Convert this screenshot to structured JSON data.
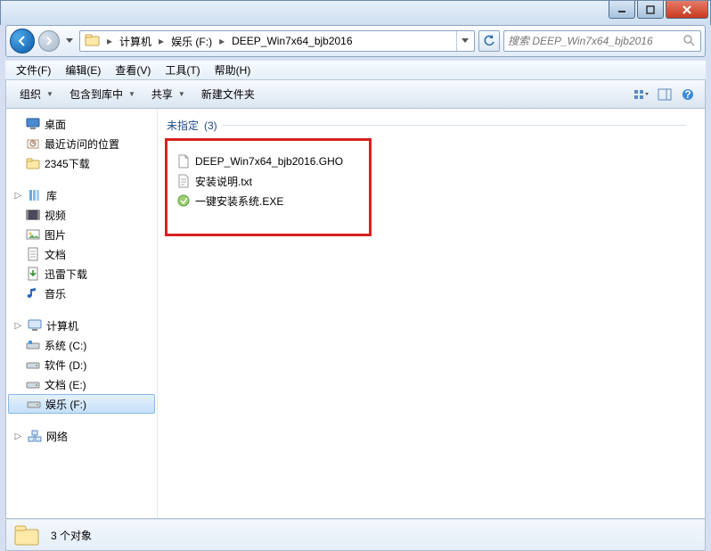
{
  "titlebar": {},
  "nav": {
    "breadcrumb": [
      "计算机",
      "娱乐 (F:)",
      "DEEP_Win7x64_bjb2016"
    ]
  },
  "search": {
    "placeholder": "搜索 DEEP_Win7x64_bjb2016"
  },
  "menubar": [
    "文件(F)",
    "编辑(E)",
    "查看(V)",
    "工具(T)",
    "帮助(H)"
  ],
  "toolbar": {
    "organize": "组织",
    "include": "包含到库中",
    "share": "共享",
    "newfolder": "新建文件夹"
  },
  "sidebar": {
    "quick": {
      "items": [
        {
          "label": "桌面",
          "icon": "desktop"
        },
        {
          "label": "最近访问的位置",
          "icon": "recent"
        },
        {
          "label": "2345下载",
          "icon": "folder"
        }
      ]
    },
    "libraries": {
      "header": "库",
      "items": [
        {
          "label": "视频",
          "icon": "video"
        },
        {
          "label": "图片",
          "icon": "picture"
        },
        {
          "label": "文档",
          "icon": "document"
        },
        {
          "label": "迅雷下载",
          "icon": "download"
        },
        {
          "label": "音乐",
          "icon": "music"
        }
      ]
    },
    "computer": {
      "header": "计算机",
      "items": [
        {
          "label": "系统 (C:)",
          "icon": "drive-sys"
        },
        {
          "label": "软件 (D:)",
          "icon": "drive"
        },
        {
          "label": "文档 (E:)",
          "icon": "drive"
        },
        {
          "label": "娱乐 (F:)",
          "icon": "drive",
          "selected": true
        }
      ]
    },
    "network": {
      "header": "网络"
    }
  },
  "files": {
    "group_label": "未指定",
    "group_count": "(3)",
    "items": [
      {
        "name": "DEEP_Win7x64_bjb2016.GHO",
        "icon": "file"
      },
      {
        "name": "安装说明.txt",
        "icon": "txt"
      },
      {
        "name": "一键安装系统.EXE",
        "icon": "exe"
      }
    ]
  },
  "status": {
    "text": "3 个对象"
  }
}
